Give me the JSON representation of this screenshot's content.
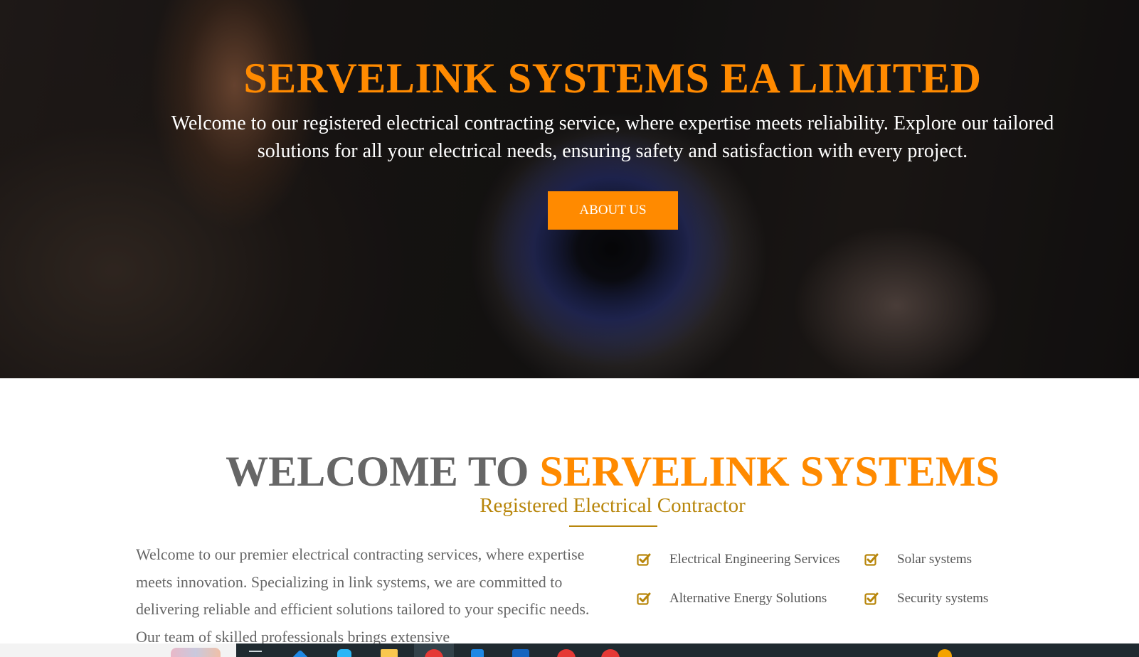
{
  "hero": {
    "title": "SERVELINK SYSTEMS EA LIMITED",
    "subtitle": "Welcome to our registered electrical contracting service, where expertise meets reliability. Explore our tailored solutions for all your electrical needs, ensuring safety and satisfaction with every project.",
    "button_label": "ABOUT US"
  },
  "welcome": {
    "title_prefix": "WELCOME TO ",
    "title_accent": "SERVELINK SYSTEMS",
    "subtitle": "Registered Electrical Contractor",
    "body": "Welcome to our premier electrical contracting services, where expertise meets innovation. Specializing in link systems, we are committed to delivering reliable and efficient solutions tailored to your specific needs. Our team of skilled professionals brings extensive"
  },
  "features": [
    {
      "label": "Electrical Engineering Services",
      "icon": "check-square-icon"
    },
    {
      "label": "Solar systems",
      "icon": "check-square-icon"
    },
    {
      "label": "Alternative Energy Solutions",
      "icon": "check-square-icon"
    },
    {
      "label": "Security systems",
      "icon": "check-square-icon"
    }
  ],
  "colors": {
    "accent_orange": "#ff8a00",
    "gold": "#b8860b",
    "text_gray": "#666666",
    "taskbar": "#1f2a30"
  },
  "taskbar": {
    "icons": [
      "weather-icon",
      "task-view-icon",
      "edge-icon",
      "store-icon",
      "file-explorer-icon",
      "chrome-icon",
      "vscode-icon",
      "word-icon",
      "chrome-profile-icon",
      "chrome-profile-2-icon",
      "notification-icon"
    ]
  }
}
